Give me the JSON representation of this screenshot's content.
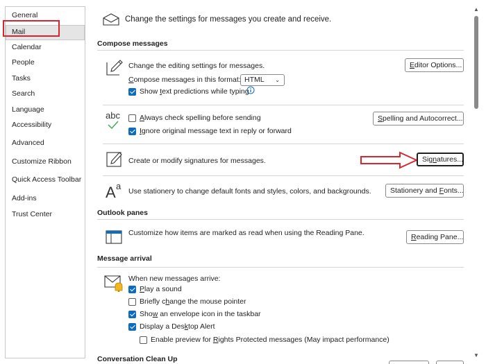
{
  "sidebar": {
    "items": [
      "General",
      "Mail",
      "Calendar",
      "People",
      "Tasks",
      "Search",
      "Language",
      "Accessibility",
      "Advanced",
      "Customize Ribbon",
      "Quick Access Toolbar",
      "Add-ins",
      "Trust Center"
    ],
    "selected": "Mail"
  },
  "header": {
    "text": "Change the settings for messages you create and receive."
  },
  "compose": {
    "title": "Compose messages",
    "editing_text": "Change the editing settings for messages.",
    "format_label_pre": "",
    "format_label_u": "C",
    "format_label_post": "ompose messages in this format:",
    "format_value": "HTML",
    "predictions_pre": "Show ",
    "predictions_u": "t",
    "predictions_post": "ext predictions while typing",
    "editor_btn_u": "E",
    "editor_btn_post": "ditor Options...",
    "spell_pre": "",
    "spell_u": "A",
    "spell_post": "lways check spelling before sending",
    "ignore_pre": "",
    "ignore_u": "I",
    "ignore_post": "gnore original message text in reply or forward",
    "spelling_btn_u": "S",
    "spelling_btn_post": "pelling and Autocorrect...",
    "abc": "abc",
    "signature_text": "Create or modify signatures for messages.",
    "signatures_btn_pre": "Sig",
    "signatures_btn_u": "n",
    "signatures_btn_post": "atures...",
    "stationery_text": "Use stationery to change default fonts and styles, colors, and backgrounds.",
    "stationery_btn_pre": "Stationery and ",
    "stationery_btn_u": "F",
    "stationery_btn_post": "onts..."
  },
  "panes": {
    "title": "Outlook panes",
    "reading_text": "Customize how items are marked as read when using the Reading Pane.",
    "reading_btn_u": "R",
    "reading_btn_post": "eading Pane..."
  },
  "arrival": {
    "title": "Message arrival",
    "when_text": "When new messages arrive:",
    "play_pre": "",
    "play_u": "P",
    "play_post": "lay a sound",
    "pointer_pre": "Briefly c",
    "pointer_u": "h",
    "pointer_post": "ange the mouse pointer",
    "envelope_pre": "Sho",
    "envelope_u": "w",
    "envelope_post": " an envelope icon in the taskbar",
    "desktop_pre": "Display a Des",
    "desktop_u": "k",
    "desktop_post": "top Alert",
    "rights_pre": "Enable preview for ",
    "rights_u": "R",
    "rights_post": "ights Protected messages (May impact performance)"
  },
  "cleanup": {
    "title": "Conversation Clean Up"
  },
  "checks": {
    "predictions": true,
    "spell": false,
    "ignore": true,
    "play": true,
    "pointer": false,
    "envelope": true,
    "desktop": true,
    "rights": false
  },
  "colors": {
    "accent": "#0f6cbd",
    "annotation": "#d9252f"
  },
  "icons": [
    "envelope-icon",
    "pen-edit-icon",
    "info-icon",
    "abc-check-icon",
    "signature-icon",
    "stationery-icon",
    "reading-pane-icon",
    "envelope-bell-icon",
    "red-arrow-icon"
  ]
}
